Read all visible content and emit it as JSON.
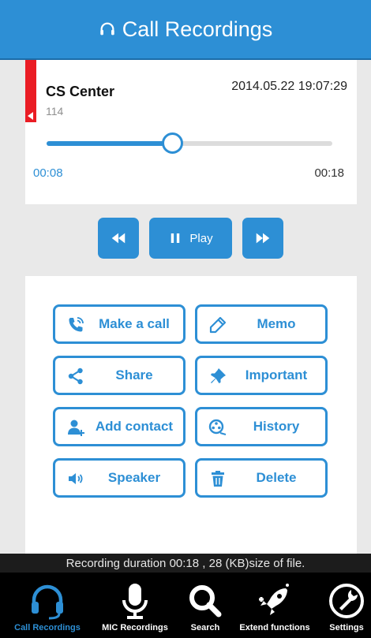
{
  "header": {
    "title": "Call Recordings",
    "icon": "headset-icon",
    "color": "#2d8fd5"
  },
  "recording": {
    "contact_name": "CS Center",
    "number": "114",
    "datetime": "2014.05.22 19:07:29",
    "current_time": "00:08",
    "total_time": "00:18",
    "progress_fraction": 0.44
  },
  "controls": {
    "rewind_icon": "rewind-icon",
    "play_label": "Play",
    "pause_icon": "pause-icon",
    "forward_icon": "fast-forward-icon"
  },
  "actions": [
    {
      "label": "Make a call",
      "icon": "phone-icon"
    },
    {
      "label": "Memo",
      "icon": "pencil-icon"
    },
    {
      "label": "Share",
      "icon": "share-icon"
    },
    {
      "label": "Important",
      "icon": "pin-icon"
    },
    {
      "label": "Add contact",
      "icon": "add-contact-icon"
    },
    {
      "label": "History",
      "icon": "history-icon"
    },
    {
      "label": "Speaker",
      "icon": "speaker-icon"
    },
    {
      "label": "Delete",
      "icon": "trash-icon"
    }
  ],
  "status": {
    "text": "Recording duration 00:18 , 28 (KB)size of file."
  },
  "tabs": [
    {
      "label": "Call Recordings",
      "icon": "headset-icon",
      "active": true
    },
    {
      "label": "MIC Recordings",
      "icon": "microphone-icon",
      "active": false
    },
    {
      "label": "Search",
      "icon": "search-icon",
      "active": false
    },
    {
      "label": "Extend functions",
      "icon": "rocket-icon",
      "active": false
    },
    {
      "label": "Settings",
      "icon": "wrench-icon",
      "active": false
    }
  ],
  "colors": {
    "accent": "#2d8fd5",
    "marker": "#ea1c24"
  }
}
